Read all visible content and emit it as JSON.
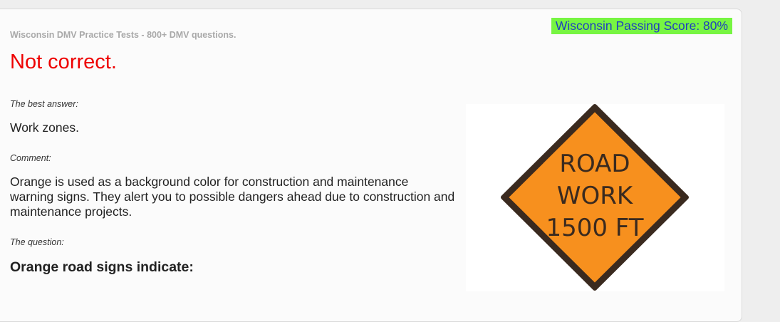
{
  "header": {
    "site_title": "Wisconsin DMV Practice Tests - 800+ DMV questions.",
    "passing_score": "Wisconsin Passing Score: 80%"
  },
  "result": {
    "title": "Not correct.",
    "best_answer_label": "The best answer:",
    "best_answer": "Work zones.",
    "comment_label": "Comment:",
    "comment": "Orange is used as a background color for construction and maintenance warning signs. They alert you to possible dangers ahead due to construction and maintenance projects.",
    "question_label": "The question:",
    "question": "Orange road signs indicate:"
  },
  "sign": {
    "line1": "ROAD",
    "line2": "WORK",
    "line3": "1500 FT"
  },
  "colors": {
    "result_title": "#ee0000",
    "score_background": "#77f542",
    "score_text": "#1f3fbf",
    "sign_fill": "#f7901e",
    "sign_border": "#3a2a1f"
  }
}
